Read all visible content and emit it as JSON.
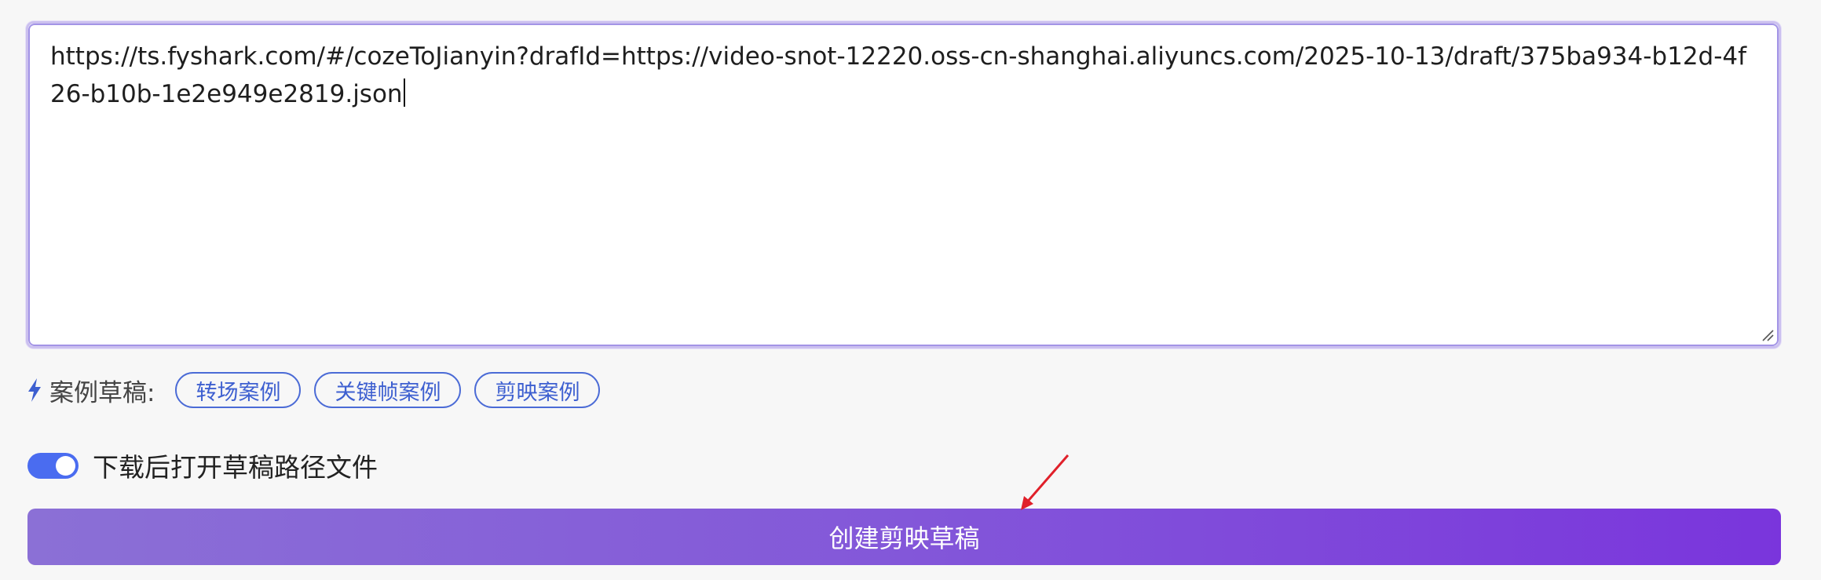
{
  "editor": {
    "url_text": "https://ts.fyshark.com/#/cozeToJianyin?drafId=https://video-snot-12220.oss-cn-shanghai.aliyuncs.com/2025-10-13/draft/375ba934-b12d-4f26-b10b-1e2e949e2819.json"
  },
  "examples": {
    "label": "案例草稿:",
    "icon": "bolt-icon",
    "items": [
      {
        "label": "转场案例"
      },
      {
        "label": "关键帧案例"
      },
      {
        "label": "剪映案例"
      }
    ]
  },
  "options": {
    "open_after_download": {
      "label": "下载后打开草稿路径文件",
      "enabled": true
    }
  },
  "actions": {
    "create_label": "创建剪映草稿"
  },
  "colors": {
    "accent_blue": "#4a6cf0",
    "chip_blue": "#3d5fd0",
    "button_gradient_start": "#8b70d6",
    "button_gradient_end": "#7a35dc",
    "annotation_red": "#e0202a"
  }
}
